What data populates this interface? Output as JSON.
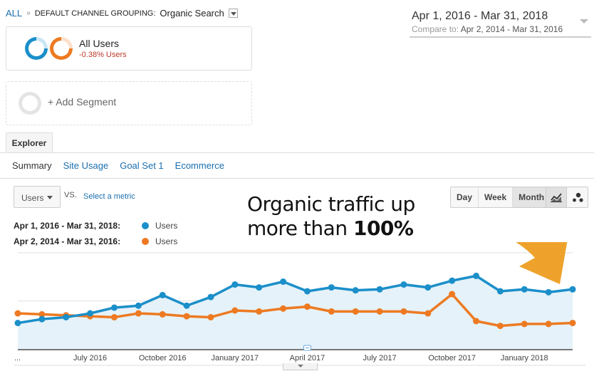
{
  "breadcrumb": {
    "root": "ALL",
    "separator": "»",
    "group": "DEFAULT CHANNEL GROUPING:",
    "value": "Organic Search"
  },
  "segments": [
    {
      "title": "All Users",
      "subtitle": "-0.38% Users"
    },
    {
      "title": "+ Add Segment"
    }
  ],
  "date_range": {
    "primary": "Apr 1, 2016 - Mar 31, 2018",
    "compare_label": "Compare to:",
    "compare": "Apr 2, 2014 - Mar 31, 2016"
  },
  "tabs": {
    "explorer": "Explorer"
  },
  "subtabs": [
    "Summary",
    "Site Usage",
    "Goal Set 1",
    "Ecommerce"
  ],
  "metric": {
    "selected": "Users",
    "vs": "VS.",
    "select_link": "Select a metric"
  },
  "legend": [
    {
      "range": "Apr 1, 2016 - Mar 31, 2018:",
      "name": "Users",
      "color": "#1b8fc9"
    },
    {
      "range": "Apr 2, 2014 - Mar 31, 2016:",
      "name": "Users",
      "color": "#ed7a22"
    }
  ],
  "granularity": {
    "options": [
      "Day",
      "Week",
      "Month"
    ],
    "selected": "Month"
  },
  "chart_types": [
    "line-chart-icon",
    "motion-chart-icon"
  ],
  "annotation": {
    "line1": "Organic traffic up",
    "line2_plain": "more than ",
    "line2_bold": "100%",
    "arrow_color": "#eea22b"
  },
  "colors": {
    "blue": "#1b8fc9",
    "orange": "#ed7a22",
    "fill": "#e5f2f9",
    "link": "#1a6fb0",
    "negative": "#c0392b"
  },
  "chart_data": {
    "type": "line",
    "title": "",
    "xlabel": "",
    "ylabel": "Users (relative scale; axis values not shown)",
    "ylim": [
      0,
      100
    ],
    "grid": true,
    "x_tick_labels": [
      "...",
      "July 2016",
      "October 2016",
      "January 2017",
      "April 2017",
      "July 2017",
      "October 2017",
      "January 2018"
    ],
    "x_tick_index": [
      0,
      3,
      6,
      9,
      12,
      15,
      18,
      21
    ],
    "x": [
      "Apr 2016",
      "May 2016",
      "Jun 2016",
      "Jul 2016",
      "Aug 2016",
      "Sep 2016",
      "Oct 2016",
      "Nov 2016",
      "Dec 2016",
      "Jan 2017",
      "Feb 2017",
      "Mar 2017",
      "Apr 2017",
      "May 2017",
      "Jun 2017",
      "Jul 2017",
      "Aug 2017",
      "Sep 2017",
      "Oct 2017",
      "Nov 2017",
      "Dec 2017",
      "Jan 2018",
      "Feb 2018",
      "Mar 2018"
    ],
    "series": [
      {
        "name": "Users (Apr 1, 2016 - Mar 31, 2018)",
        "color": "#1b8fc9",
        "filled": true,
        "values": [
          27,
          31,
          33,
          37,
          43,
          45,
          56,
          45,
          54,
          67,
          64,
          70,
          60,
          64,
          61,
          62,
          67,
          64,
          71,
          76,
          60,
          62,
          59,
          62
        ]
      },
      {
        "name": "Users (Apr 2, 2014 - Mar 31, 2016)",
        "color": "#ed7a22",
        "filled": false,
        "values": [
          37,
          36,
          35,
          34,
          33,
          37,
          36,
          34,
          33,
          40,
          39,
          42,
          44,
          39,
          39,
          39,
          39,
          37,
          57,
          29,
          24,
          26,
          26,
          27
        ]
      }
    ]
  }
}
